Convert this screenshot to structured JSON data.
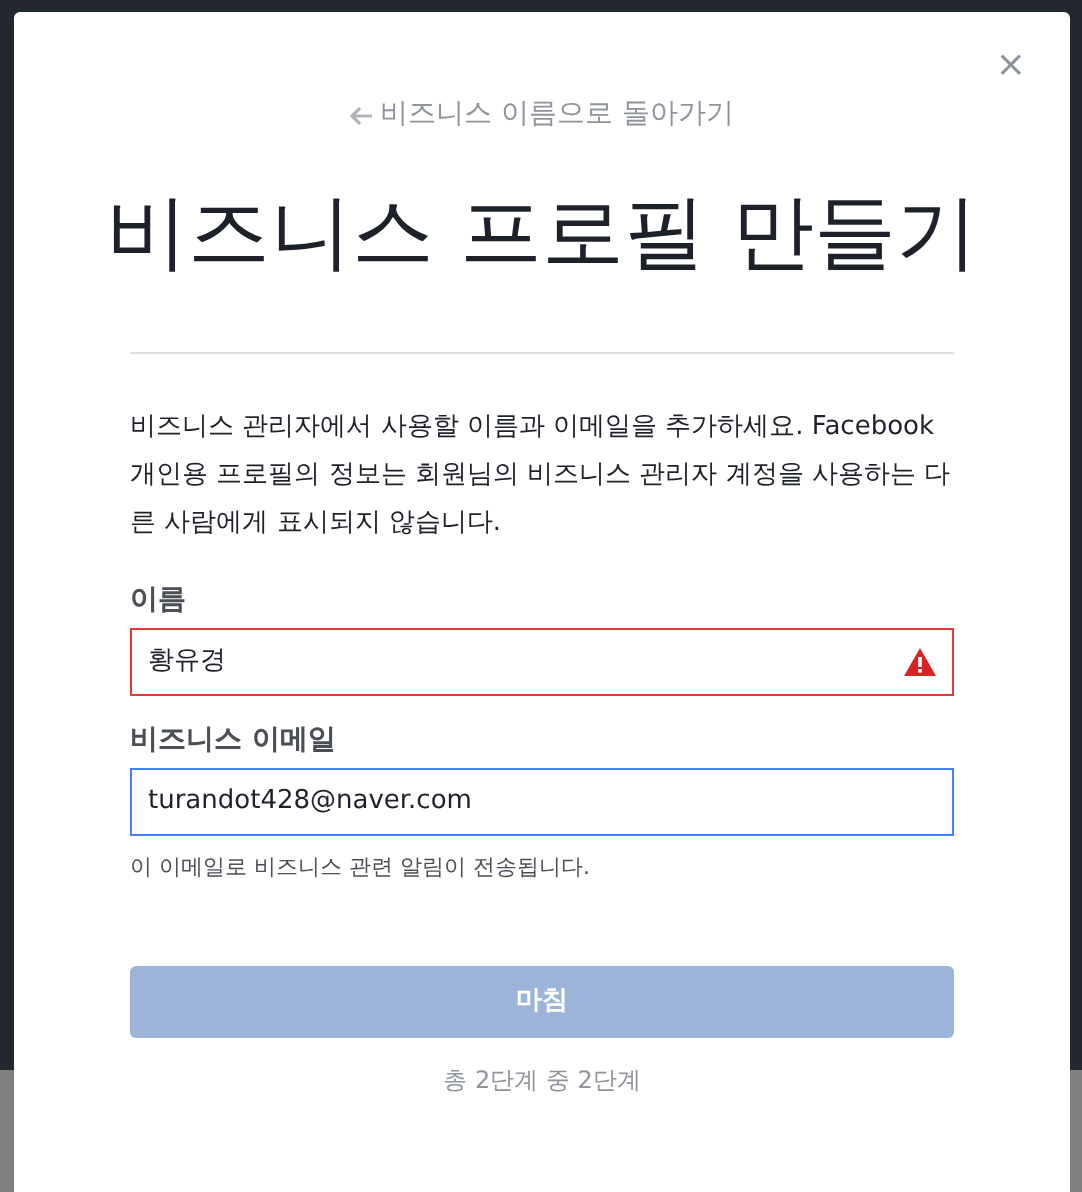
{
  "dialog": {
    "back_link": "비즈니스 이름으로 돌아가기",
    "close": "×",
    "title": "비즈니스 프로필 만들기",
    "description": "비즈니스 관리자에서 사용할 이름과 이메일을 추가하세요. Facebook 개인용 프로필의 정보는 회원님의 비즈니스 관리자 계정을 사용하는 다른 사람에게 표시되지 않습니다.",
    "fields": [
      {
        "label": "이름",
        "value": "황유경",
        "error": true,
        "focused": false
      },
      {
        "label": "비즈니스 이메일",
        "value": "turandot428@naver.com",
        "error": false,
        "focused": true,
        "hint": "이 이메일로 비즈니스 관련 알림이 전송됩니다."
      }
    ],
    "submit": {
      "label": "마침",
      "disabled": true
    },
    "step": "총 2단계 중 2단계"
  }
}
